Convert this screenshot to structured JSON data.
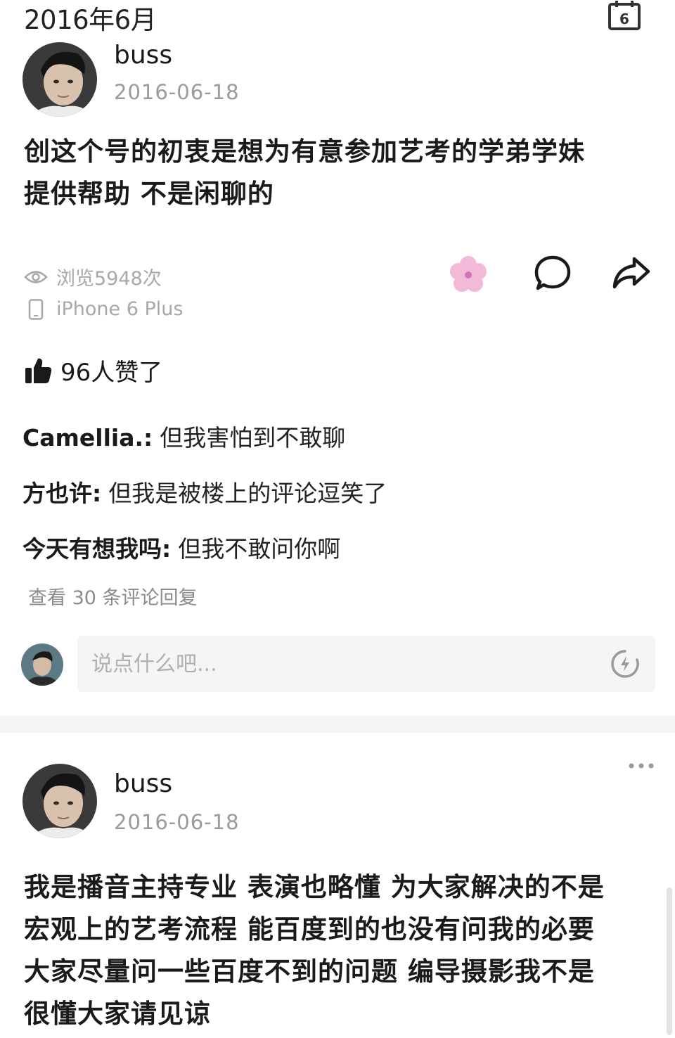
{
  "header": {
    "month_title": "2016年6月",
    "calendar_day": "6"
  },
  "posts": [
    {
      "author": "buss",
      "date": "2016-06-18",
      "body_lines": [
        "创这个号的初衷是想为有意参加艺考的学弟学妹",
        "提供帮助 不是闲聊的"
      ],
      "views": "浏览5948次",
      "device": "iPhone 6 Plus",
      "likes": "96人赞了",
      "comments": [
        {
          "author": "Camellia.:",
          "text": "但我害怕到不敢聊"
        },
        {
          "author": "方也许:",
          "text": "但我是被楼上的评论逗笑了"
        },
        {
          "author": "今天有想我吗:",
          "text": "但我不敢问你啊"
        }
      ],
      "view_replies": "查看 30 条评论回复",
      "reply_placeholder": "说点什么吧..."
    },
    {
      "author": "buss",
      "date": "2016-06-18",
      "body_lines": [
        "我是播音主持专业 表演也略懂 为大家解决的不是",
        "宏观上的艺考流程 能百度到的也没有问我的必要",
        "大家尽量问一些百度不到的问题 编导摄影我不是",
        "很懂大家请见谅"
      ]
    }
  ],
  "icons": {
    "calendar": "calendar-icon",
    "eye": "eye-icon",
    "phone": "phone-icon",
    "flower": "flower-icon",
    "comment": "comment-icon",
    "share": "share-icon",
    "thumb": "thumbs-up-icon",
    "lightning": "lightning-icon",
    "more": "more-icon"
  },
  "colors": {
    "text": "#1a1a1a",
    "muted": "#9a9a9a",
    "input_bg": "#f5f5f7",
    "flower_pink": "#f3b9d9"
  }
}
